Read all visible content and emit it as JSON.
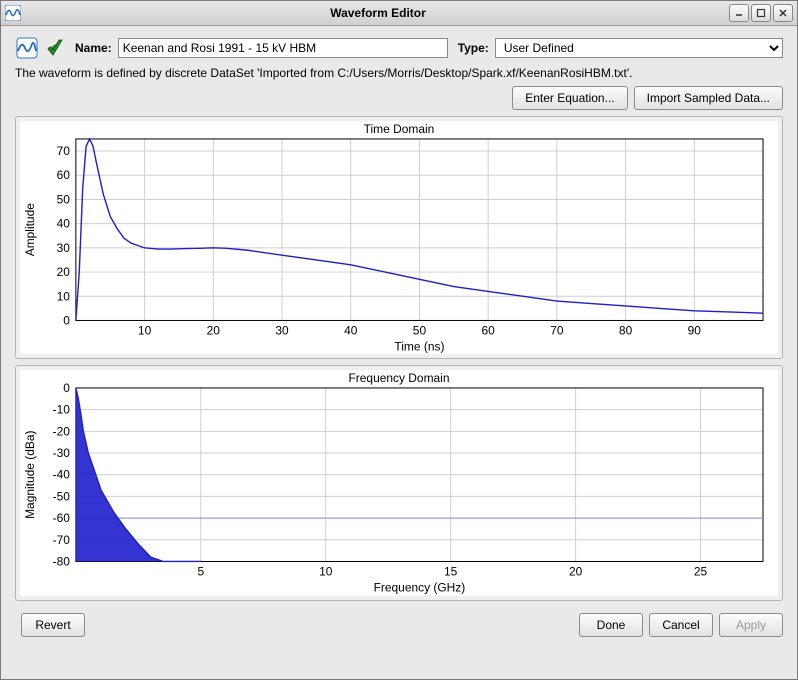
{
  "window": {
    "title": "Waveform Editor"
  },
  "header": {
    "name_label": "Name:",
    "name_value": "Keenan and Rosi 1991 - 15 kV HBM",
    "type_label": "Type:",
    "type_value": "User Defined",
    "type_options": [
      "User Defined"
    ]
  },
  "description": "The waveform is defined by discrete DataSet 'Imported from C:/Users/Morris/Desktop/Spark.xf/KeenanRosiHBM.txt'.",
  "buttons": {
    "enter_equation": "Enter Equation...",
    "import_sampled": "Import Sampled Data...",
    "revert": "Revert",
    "done": "Done",
    "cancel": "Cancel",
    "apply": "Apply"
  },
  "chart_data": [
    {
      "type": "line",
      "title": "Time Domain",
      "xlabel": "Time (ns)",
      "ylabel": "Amplitude",
      "xlim": [
        0,
        100
      ],
      "ylim": [
        0,
        75
      ],
      "xticks": [
        10,
        20,
        30,
        40,
        50,
        60,
        70,
        80,
        90
      ],
      "yticks": [
        0,
        10,
        20,
        30,
        40,
        50,
        60,
        70
      ],
      "series": [
        {
          "name": "amplitude",
          "x": [
            0,
            0.5,
            1,
            1.5,
            2,
            2.5,
            3,
            4,
            5,
            6,
            7,
            8,
            10,
            12,
            14,
            16,
            18,
            20,
            22,
            25,
            30,
            35,
            40,
            45,
            50,
            55,
            60,
            65,
            70,
            75,
            80,
            85,
            90,
            95,
            100
          ],
          "values": [
            0,
            20,
            55,
            72,
            75,
            72,
            65,
            52,
            43,
            38,
            34,
            32,
            30,
            29.5,
            29.5,
            29.7,
            29.8,
            30,
            29.8,
            29,
            27,
            25,
            23,
            20,
            17,
            14,
            12,
            10,
            8,
            7,
            6,
            5,
            4,
            3.5,
            3
          ]
        }
      ]
    },
    {
      "type": "area",
      "title": "Frequency Domain",
      "xlabel": "Frequency (GHz)",
      "ylabel": "Magnitude (dBa)",
      "xlim": [
        0,
        27.5
      ],
      "ylim": [
        -80,
        0
      ],
      "xticks": [
        5,
        10,
        15,
        20,
        25
      ],
      "yticks": [
        -80,
        -70,
        -60,
        -50,
        -40,
        -30,
        -20,
        -10,
        0
      ],
      "hline": -60,
      "series": [
        {
          "name": "envelope",
          "x": [
            0,
            0.1,
            0.2,
            0.3,
            0.5,
            0.8,
            1.0,
            1.5,
            2.0,
            2.5,
            3.0,
            3.5,
            4.0,
            4.5,
            5.0
          ],
          "values": [
            0,
            -5,
            -12,
            -20,
            -30,
            -40,
            -47,
            -57,
            -65,
            -72,
            -78,
            -80,
            -80,
            -80,
            -80
          ]
        }
      ]
    }
  ]
}
